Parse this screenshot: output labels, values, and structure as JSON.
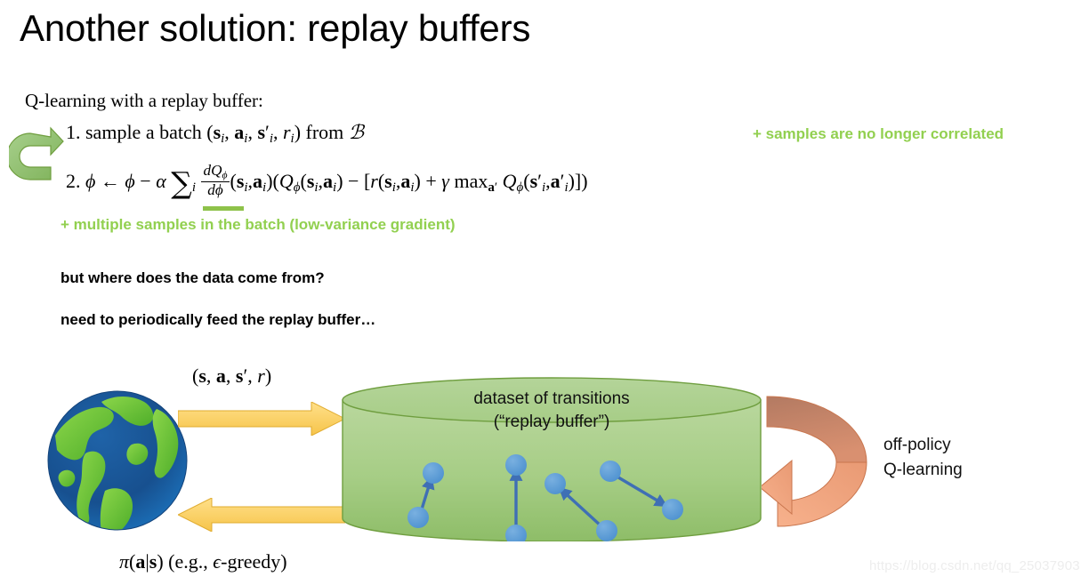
{
  "slide": {
    "title": "Another solution: replay buffers",
    "background_color": "#ffffff"
  },
  "algorithm": {
    "heading": "Q-learning with a replay buffer:",
    "step1": {
      "number": "1.",
      "text_plain": "sample a batch (s_i, a_i, s'_i, r_i) from B",
      "lead": "sample a batch",
      "tuple_open": "(",
      "tuple_s": "s",
      "tuple_comma1": ",",
      "tuple_a": "a",
      "tuple_comma2": ",",
      "tuple_sp": "s",
      "tuple_prime": "′",
      "tuple_comma3": ",",
      "tuple_r": "r",
      "tuple_close": ")",
      "from": "from",
      "buffer_symbol": "ℬ",
      "subscript": "i"
    },
    "step2": {
      "number": "2.",
      "text_plain": "ϕ ← ϕ − α Σ_i dQϕ/dϕ (s_i, a_i)(Qϕ(s_i, a_i) − [r(s_i, a_i) + γ max_a' Qϕ(s'_i, a'_i)])",
      "phi": "ϕ",
      "arrow": "←",
      "minus": "−",
      "alpha": "α",
      "sum": "∑",
      "sum_index": "i",
      "frac_num": "dQ",
      "frac_den": "d",
      "gamma": "γ",
      "max": "max",
      "r": "r",
      "Q": "Q",
      "prime": "′",
      "bracket_open": "[",
      "bracket_close": "]",
      "paren_open": "(",
      "paren_close": ")",
      "comma": ",",
      "s": "s",
      "a": "a",
      "subscript": "i"
    }
  },
  "annotations": {
    "green_color": "#92d050",
    "samples_not_correlated": "+ samples are no longer correlated",
    "multiple_samples": "+ multiple samples in the batch (low-variance gradient)",
    "question": "but where does the data come from?",
    "need_feed": "need to periodically feed the replay buffer…"
  },
  "diagram": {
    "globe_icon": "globe-icon",
    "loop_arrow_icon": "circular-arrow-icon",
    "uturn_arrow_icon": "u-turn-arrow-icon",
    "top_arrow_icon": "right-arrow-icon",
    "bottom_arrow_icon": "left-arrow-icon",
    "top_arrow_label_plain": "(s, a, s', r)",
    "top_arrow_label": {
      "open": "(",
      "s": "s",
      "comma1": ",",
      "a": "a",
      "comma2": ",",
      "s2": "s",
      "prime": "′",
      "comma3": ",",
      "r": "r",
      "close": ")"
    },
    "bottom_arrow_label_plain": "π(a|s) (e.g., ϵ-greedy)",
    "bottom_arrow_label": {
      "pi": "π",
      "open": "(",
      "a": "a",
      "bar": "|",
      "s": "s",
      "close": ")",
      "eg": "(e.g.,",
      "epsilon": "ϵ",
      "greedy": "-greedy)"
    },
    "cylinder": {
      "caption_line1": "dataset of transitions",
      "caption_line2": "(“replay buffer”)",
      "fill_color": "#a9cf8a",
      "stroke_color": "#6f9e3f",
      "dot_color": "#5b9bd5",
      "transition_arrow_color": "#3f6fb5"
    },
    "right_label_line1": "off-policy",
    "right_label_line2": "Q-learning",
    "arrow_color_yellow": "#ffd966",
    "arrow_color_orange": "#f4a27a"
  },
  "watermark": {
    "text": "https://blog.csdn.net/qq_25037903"
  }
}
